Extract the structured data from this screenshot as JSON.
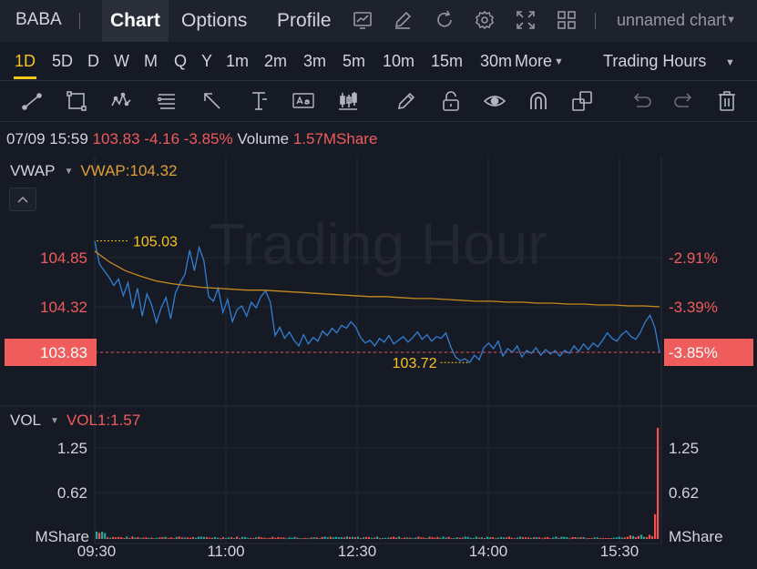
{
  "topbar": {
    "ticker": "BABA",
    "tabs": [
      "Chart",
      "Options",
      "Profile"
    ],
    "icons": [
      "chart-type-icon",
      "edit-icon",
      "refresh-icon",
      "settings-icon",
      "fullscreen-icon",
      "layout-grid-icon"
    ],
    "chart_name": "unnamed chart"
  },
  "intervals": {
    "items": [
      "1D",
      "5D",
      "D",
      "W",
      "M",
      "Q",
      "Y",
      "1m",
      "2m",
      "3m",
      "5m",
      "10m",
      "15m",
      "30m"
    ],
    "active": "1D",
    "more_label": "More",
    "session_label": "Trading Hours"
  },
  "drawing_tools": [
    "trend-line-icon",
    "rectangle-icon",
    "pattern-icon",
    "fib-icon",
    "arrow-icon",
    "measure-icon",
    "text-note-icon",
    "candle-icon",
    "pencil-icon",
    "lock-icon",
    "eye-icon",
    "magnet-icon",
    "clone-icon",
    "undo-icon",
    "redo-icon",
    "trash-icon"
  ],
  "quote": {
    "datetime": "07/09 15:59",
    "price": "103.83",
    "change": "-4.16",
    "change_pct": "-3.85%",
    "volume_label": "Volume",
    "volume": "1.57MShare"
  },
  "vwap": {
    "name": "VWAP",
    "value_label": "VWAP:104.32"
  },
  "vol_indicator": {
    "name": "VOL",
    "value_label": "VOL1:1.57"
  },
  "watermark": "Trading Hour",
  "colors": {
    "background": "#161a25",
    "price_line": "#2f7fd3",
    "vwap_line": "#c98a1c",
    "up": "#26a69a",
    "down": "#ef5350",
    "highlight": "#f5c518",
    "negative_text": "#f05b5b"
  },
  "chart_data": {
    "type": "line",
    "x_tick_labels": [
      "09:30",
      "11:00",
      "12:30",
      "14:00",
      "15:30"
    ],
    "y_tick_labels_left": [
      "104.85",
      "104.32",
      "103.83"
    ],
    "y_tick_labels_right": [
      "-2.91%",
      "-3.39%",
      "-3.85%"
    ],
    "ylim": [
      103.66,
      105.18
    ],
    "high_label": "105.03",
    "low_label": "103.72",
    "current_price": 103.83,
    "series": [
      {
        "name": "Price",
        "values": [
          105.03,
          104.78,
          104.71,
          104.64,
          104.55,
          104.62,
          104.44,
          104.58,
          104.3,
          104.52,
          104.22,
          104.46,
          104.34,
          104.15,
          104.31,
          104.42,
          104.19,
          104.47,
          104.58,
          104.67,
          104.93,
          104.71,
          104.96,
          104.82,
          104.43,
          104.38,
          104.52,
          104.26,
          104.4,
          104.16,
          104.29,
          104.33,
          104.22,
          104.37,
          104.31,
          104.43,
          104.49,
          104.37,
          104.01,
          104.1,
          103.98,
          104.05,
          103.96,
          103.9,
          104.02,
          103.92,
          103.99,
          103.95,
          104.06,
          104.01,
          104.09,
          104.04,
          104.12,
          104.09,
          104.16,
          104.1,
          103.99,
          103.93,
          103.96,
          103.9,
          103.98,
          103.94,
          104.01,
          103.92,
          103.96,
          104.0,
          103.94,
          103.99,
          104.05,
          103.97,
          104.02,
          103.95,
          104.0,
          103.98,
          104.04,
          103.89,
          103.78,
          103.74,
          103.76,
          103.72,
          103.8,
          103.75,
          103.88,
          103.93,
          103.87,
          103.95,
          103.79,
          103.87,
          103.83,
          103.9,
          103.78,
          103.85,
          103.82,
          103.88,
          103.8,
          103.86,
          103.81,
          103.85,
          103.79,
          103.85,
          103.82,
          103.9,
          103.84,
          103.92,
          103.86,
          103.93,
          103.89,
          103.96,
          104.04,
          103.98,
          103.95,
          104.02,
          104.06,
          104.0,
          103.97,
          104.05,
          104.16,
          104.23,
          104.1,
          103.83
        ],
        "color": "#2f7fd3"
      },
      {
        "name": "VWAP",
        "values": [
          104.92,
          104.8,
          104.71,
          104.65,
          104.6,
          104.57,
          104.55,
          104.53,
          104.52,
          104.51,
          104.5,
          104.5,
          104.49,
          104.48,
          104.47,
          104.46,
          104.45,
          104.44,
          104.43,
          104.43,
          104.42,
          104.41,
          104.41,
          104.4,
          104.39,
          104.38,
          104.38,
          104.37,
          104.37,
          104.36,
          104.36,
          104.35,
          104.35,
          104.34,
          104.34,
          104.33,
          104.33,
          104.32
        ],
        "color": "#c98a1c"
      },
      {
        "name": "VOL",
        "yticks": [
          "1.25",
          "0.62"
        ],
        "unit": "MShare",
        "max": 1.57
      }
    ]
  }
}
